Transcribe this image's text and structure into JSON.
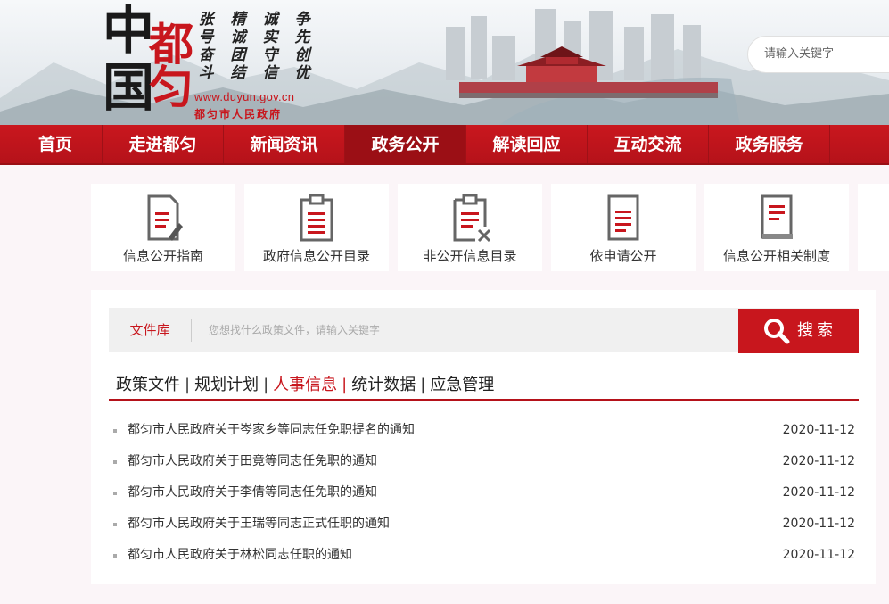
{
  "header": {
    "logo_chars": [
      "中",
      "都",
      "国",
      "匀"
    ],
    "slogans": [
      [
        "张",
        "号",
        "奋",
        "斗"
      ],
      [
        "精",
        "诚",
        "团",
        "结"
      ],
      [
        "诚",
        "实",
        "守",
        "信"
      ],
      [
        "争",
        "先",
        "创",
        "优"
      ]
    ],
    "url": "www.duyun.gov.cn",
    "gov_name": "都匀市人民政府",
    "search_placeholder": "请输入关键字"
  },
  "nav": {
    "items": [
      "首页",
      "走进都匀",
      "新闻资讯",
      "政务公开",
      "解读回应",
      "互动交流",
      "政务服务"
    ],
    "active_index": 3
  },
  "cards": [
    {
      "label": "信息公开指南",
      "icon": "document-pen-icon"
    },
    {
      "label": "政府信息公开目录",
      "icon": "clipboard-list-icon"
    },
    {
      "label": "非公开信息目录",
      "icon": "clipboard-x-icon"
    },
    {
      "label": "依申请公开",
      "icon": "document-list-icon"
    },
    {
      "label": "信息公开相关制度",
      "icon": "book-icon"
    }
  ],
  "filebar": {
    "library_label": "文件库",
    "placeholder": "您想找什么政策文件，请输入关键字",
    "search_button": "搜索"
  },
  "tabs": {
    "items": [
      "政策文件",
      "规划计划",
      "人事信息",
      "统计数据",
      "应急管理"
    ],
    "active_index": 2
  },
  "list": [
    {
      "title": "都匀市人民政府关于岑家乡等同志任免职提名的通知",
      "date": "2020-11-12"
    },
    {
      "title": "都匀市人民政府关于田竟等同志任免职的通知",
      "date": "2020-11-12"
    },
    {
      "title": "都匀市人民政府关于李倩等同志任免职的通知",
      "date": "2020-11-12"
    },
    {
      "title": "都匀市人民政府关于王瑞等同志正式任职的通知",
      "date": "2020-11-12"
    },
    {
      "title": "都匀市人民政府关于林松同志任职的通知",
      "date": "2020-11-12"
    }
  ],
  "colors": {
    "brand_red": "#c8161d",
    "nav_active": "#9b0f15"
  }
}
